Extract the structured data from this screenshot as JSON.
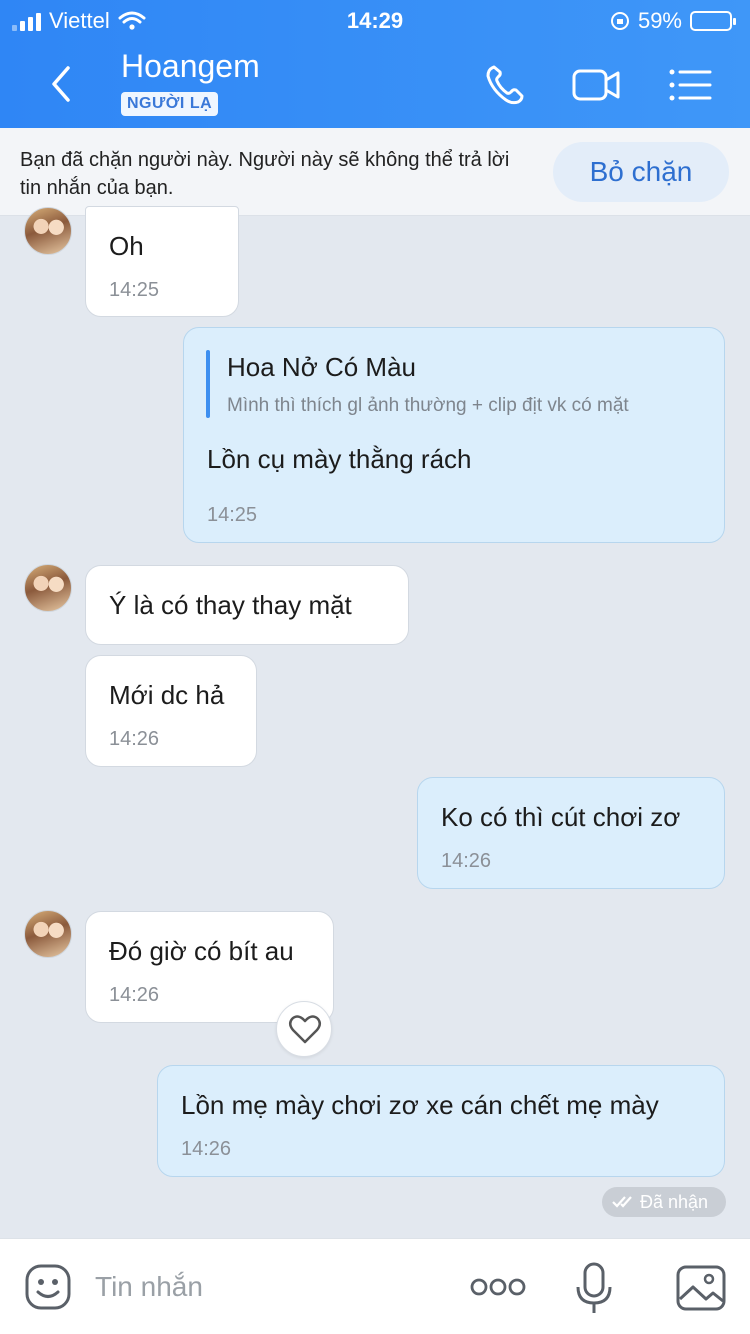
{
  "status_bar": {
    "carrier": "Viettel",
    "time": "14:29",
    "battery": "59%",
    "battery_level": 0.59
  },
  "header": {
    "title": "Hoangem",
    "tag": "NGƯỜI LẠ",
    "icons": [
      "back-icon",
      "phone-icon",
      "video-icon",
      "menu-icon"
    ]
  },
  "banner": {
    "text": "Bạn đã chặn người này. Người này sẽ không thể trả lời tin nhắn của bạn.",
    "button": "Bỏ chặn"
  },
  "messages": [
    {
      "side": "in",
      "text": "Oh",
      "time": "14:25"
    },
    {
      "side": "out",
      "quote_name": "Hoa Nở Có Màu",
      "quote_text": "Mình thì thích gl ảnh thường + clip địt vk có mặt",
      "text": "Lồn cụ mày thằng rách",
      "time": "14:25"
    },
    {
      "side": "in",
      "text": "Ý là có thay thay mặt"
    },
    {
      "side": "in",
      "text": "Mới dc hả",
      "time": "14:26"
    },
    {
      "side": "out",
      "text": "Ko có thì cút chơi zơ",
      "time": "14:26"
    },
    {
      "side": "in",
      "text": "Đó giờ có bít au",
      "time": "14:26"
    },
    {
      "side": "out",
      "text": "Lồn mẹ mày chơi zơ xe cán chết mẹ mày",
      "time": "14:26"
    }
  ],
  "received_label": "Đã nhận",
  "composer": {
    "placeholder": "Tin nhắn",
    "icons": [
      "sticker-icon",
      "more-icon",
      "mic-icon",
      "image-icon"
    ]
  },
  "colors": {
    "header": "#2f86f5",
    "out_bubble": "#dbeefc",
    "chat_bg": "#e3e8ef",
    "accent": "#2e6fd0"
  }
}
